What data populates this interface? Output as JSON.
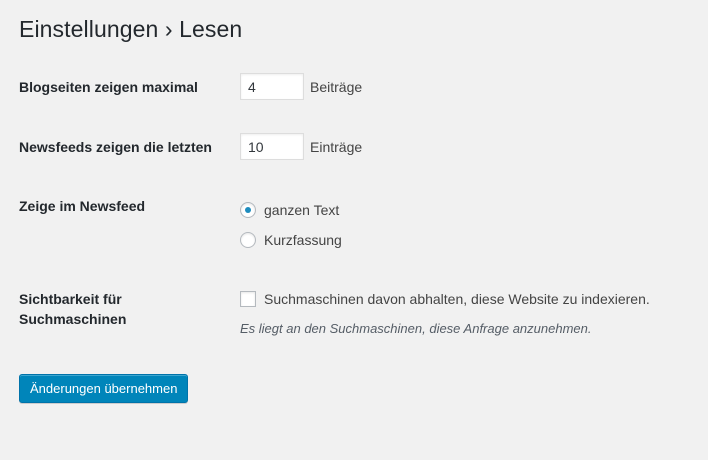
{
  "page": {
    "title": "Einstellungen › Lesen"
  },
  "blog_pages": {
    "label": "Blogseiten zeigen maximal",
    "value": "4",
    "unit": "Beiträge"
  },
  "feeds": {
    "label": "Newsfeeds zeigen die letzten",
    "value": "10",
    "unit": "Einträge"
  },
  "feed_content": {
    "label": "Zeige im Newsfeed",
    "options": [
      {
        "label": "ganzen Text",
        "selected": true
      },
      {
        "label": "Kurzfassung",
        "selected": false
      }
    ]
  },
  "visibility": {
    "label_line1": "Sichtbarkeit für",
    "label_line2": "Suchmaschinen",
    "checkbox_label": "Suchmaschinen davon abhalten, diese Website zu indexieren.",
    "checked": false,
    "description": "Es liegt an den Suchmaschinen, diese Anfrage anzunehmen."
  },
  "submit": {
    "label": "Änderungen übernehmen"
  },
  "colors": {
    "background": "#f1f1f1",
    "primary_button": "#0085ba",
    "radio_dot": "#1e8cbe"
  }
}
